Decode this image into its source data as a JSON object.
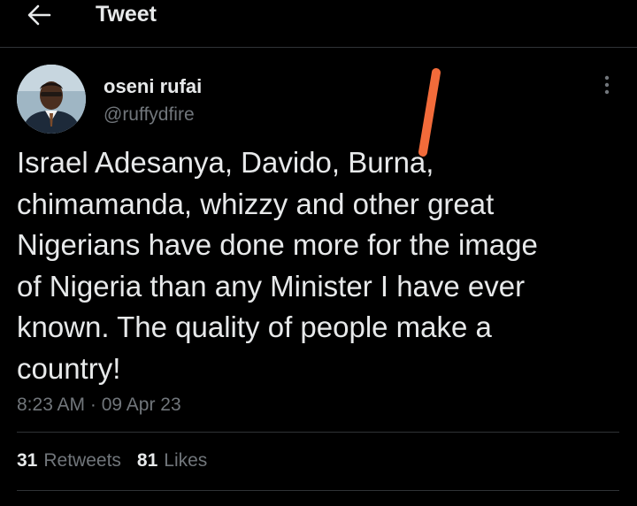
{
  "header": {
    "title": "Tweet",
    "back_icon": "arrow-left-icon"
  },
  "author": {
    "name": "oseni rufai",
    "handle": "@ruffydfire"
  },
  "tweet": {
    "text": "Israel Adesanya, Davido, Burna,\nchimamanda, whizzy and other great\nNigerians have done more for the image\nof Nigeria than any Minister I have ever\nknown. The quality of people make a\ncountry!",
    "time": "8:23 AM",
    "separator": "·",
    "date": "09 Apr 23"
  },
  "stats": {
    "retweets_count": "31",
    "retweets_label": "Retweets",
    "likes_count": "81",
    "likes_label": "Likes"
  },
  "colors": {
    "background": "#000000",
    "text_primary": "#e7e9ea",
    "text_secondary": "#71767b",
    "divider": "#2f3336",
    "annotation_mark": "#f26b3a"
  }
}
